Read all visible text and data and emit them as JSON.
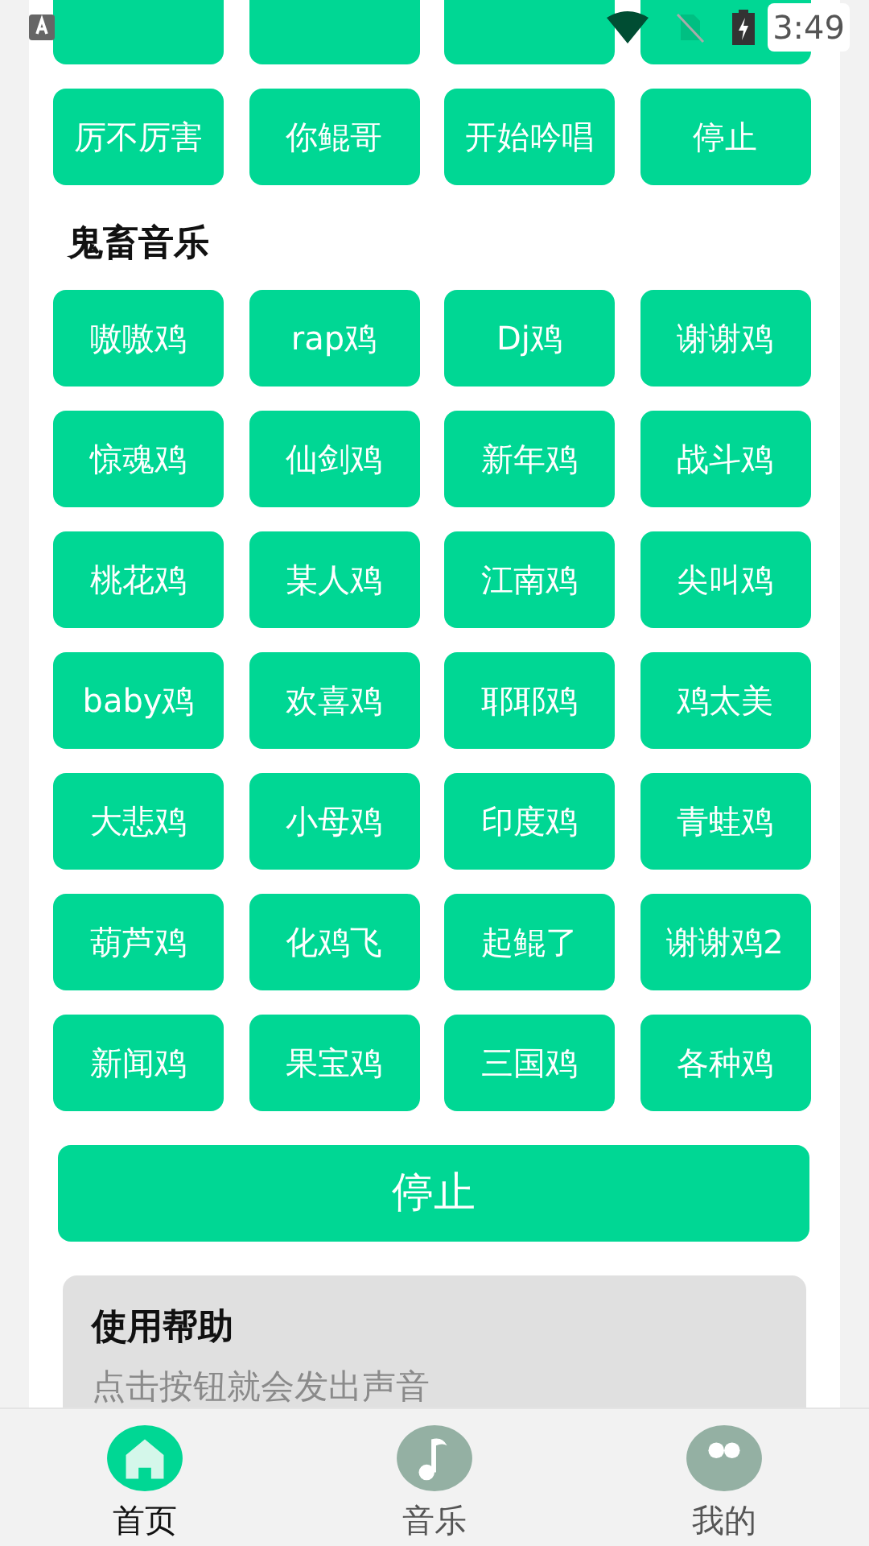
{
  "status_bar": {
    "time": "3:49"
  },
  "partial_row": [
    {
      "kind": "button"
    },
    {
      "kind": "button"
    },
    {
      "kind": "button"
    },
    {
      "kind": "button"
    }
  ],
  "first_row": [
    "厉不厉害",
    "你鲲哥",
    "开始吟唱",
    "停止"
  ],
  "section": {
    "title": "鬼畜音乐",
    "buttons": [
      "嗷嗷鸡",
      "rap鸡",
      "Dj鸡",
      "谢谢鸡",
      "惊魂鸡",
      "仙剑鸡",
      "新年鸡",
      "战斗鸡",
      "桃花鸡",
      "某人鸡",
      "江南鸡",
      "尖叫鸡",
      "baby鸡",
      "欢喜鸡",
      "耶耶鸡",
      "鸡太美",
      "大悲鸡",
      "小母鸡",
      "印度鸡",
      "青蛙鸡",
      "葫芦鸡",
      "化鸡飞",
      "起鲲了",
      "谢谢鸡2",
      "新闻鸡",
      "果宝鸡",
      "三国鸡",
      "各种鸡"
    ]
  },
  "stop_button": "停止",
  "help": {
    "title": "使用帮助",
    "text": "点击按钮就会发出声音"
  },
  "tabs": [
    {
      "kind": "home",
      "label": "首页",
      "selected": true
    },
    {
      "kind": "music",
      "label": "音乐",
      "selected": false
    },
    {
      "kind": "profile",
      "label": "我的",
      "selected": false
    }
  ]
}
